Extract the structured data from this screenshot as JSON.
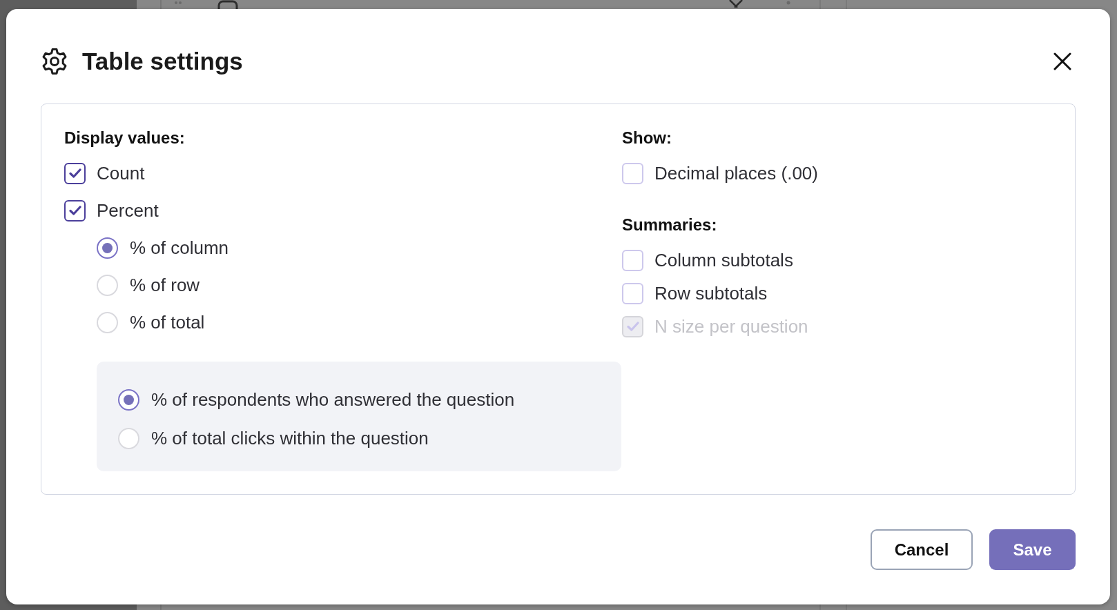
{
  "dialog": {
    "title": "Table settings"
  },
  "display_values": {
    "heading": "Display values:",
    "options": [
      {
        "label": "Count",
        "checked": true,
        "disabled": false
      },
      {
        "label": "Percent",
        "checked": true,
        "disabled": false
      }
    ],
    "percent_of": [
      {
        "label": "% of column",
        "selected": true
      },
      {
        "label": "% of row",
        "selected": false
      },
      {
        "label": "% of total",
        "selected": false
      }
    ],
    "percent_base": [
      {
        "label": "% of respondents who answered the question",
        "selected": true
      },
      {
        "label": "% of total clicks within the question",
        "selected": false
      }
    ]
  },
  "show": {
    "heading": "Show:",
    "options": [
      {
        "label": "Decimal places (.00)",
        "checked": false,
        "disabled": false
      }
    ]
  },
  "summaries": {
    "heading": "Summaries:",
    "options": [
      {
        "label": "Column subtotals",
        "checked": false,
        "disabled": false
      },
      {
        "label": "Row subtotals",
        "checked": false,
        "disabled": false
      },
      {
        "label": "N size per question",
        "checked": true,
        "disabled": true
      }
    ]
  },
  "buttons": [
    {
      "label": "Cancel",
      "kind": "secondary"
    },
    {
      "label": "Save",
      "kind": "primary"
    }
  ]
}
